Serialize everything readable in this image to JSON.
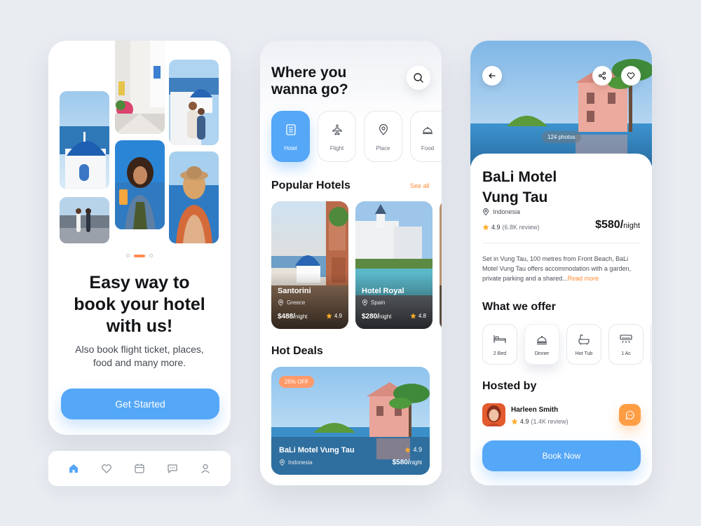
{
  "onboarding": {
    "title": "Easy way to book your hotel with us!",
    "subtitle": "Also book flight ticket, places, food and many more.",
    "cta_label": "Get Started",
    "page_dots": {
      "count": 3,
      "active_index": 1
    }
  },
  "tabbar": {
    "items": [
      {
        "icon": "home-icon",
        "active": true
      },
      {
        "icon": "heart-icon",
        "active": false
      },
      {
        "icon": "calendar-icon",
        "active": false
      },
      {
        "icon": "chat-icon",
        "active": false
      },
      {
        "icon": "user-icon",
        "active": false
      }
    ]
  },
  "home": {
    "title": "Where you wanna go?",
    "categories": [
      {
        "label": "Hotel",
        "icon": "hotel-icon",
        "active": true
      },
      {
        "label": "Flight",
        "icon": "plane-icon",
        "active": false
      },
      {
        "label": "Place",
        "icon": "map-pin-icon",
        "active": false
      },
      {
        "label": "Food",
        "icon": "cloche-icon",
        "active": false
      }
    ],
    "popular": {
      "title": "Popular Hotels",
      "see_all": "See all",
      "hotels": [
        {
          "name": "Santorini",
          "location": "Greece",
          "price": "$488/",
          "unit": "night",
          "rating": "4.9"
        },
        {
          "name": "Hotel Royal",
          "location": "Spain",
          "price": "$280/",
          "unit": "night",
          "rating": "4.8"
        }
      ]
    },
    "deals": {
      "title": "Hot Deals",
      "badge": "25% OFF",
      "name": "BaLi Motel Vung Tau",
      "location": "Indonesia",
      "price": "$580/",
      "unit": "night",
      "rating": "4.9"
    }
  },
  "detail": {
    "photos_count": "124 photos",
    "title": "BaLi Motel Vung Tau",
    "location": "Indonesia",
    "rating": "4.9",
    "reviews": "(6.8K review)",
    "price": "$580/",
    "unit": "night",
    "description": "Set in Vung Tau, 100 metres from Front Beach, BaLi Motel Vung Tau offers accommodation with a garden, private parking and a shared...",
    "read_more": "Read more",
    "offer_title": "What we offer",
    "offers": [
      {
        "label": "2 Bed",
        "icon": "bed-icon"
      },
      {
        "label": "Dinner",
        "icon": "dinner-icon"
      },
      {
        "label": "Hot Tub",
        "icon": "bathtub-icon"
      },
      {
        "label": "1 Ac",
        "icon": "ac-icon"
      }
    ],
    "host_title": "Hosted by",
    "host": {
      "name": "Harleen Smith",
      "rating": "4.9",
      "reviews": "(1.4K review)"
    },
    "book_label": "Book Now"
  },
  "colors": {
    "primary": "#55a7f8",
    "accent_orange": "#ff8a30",
    "star": "#ffae2b",
    "background": "#e9ecf1"
  }
}
